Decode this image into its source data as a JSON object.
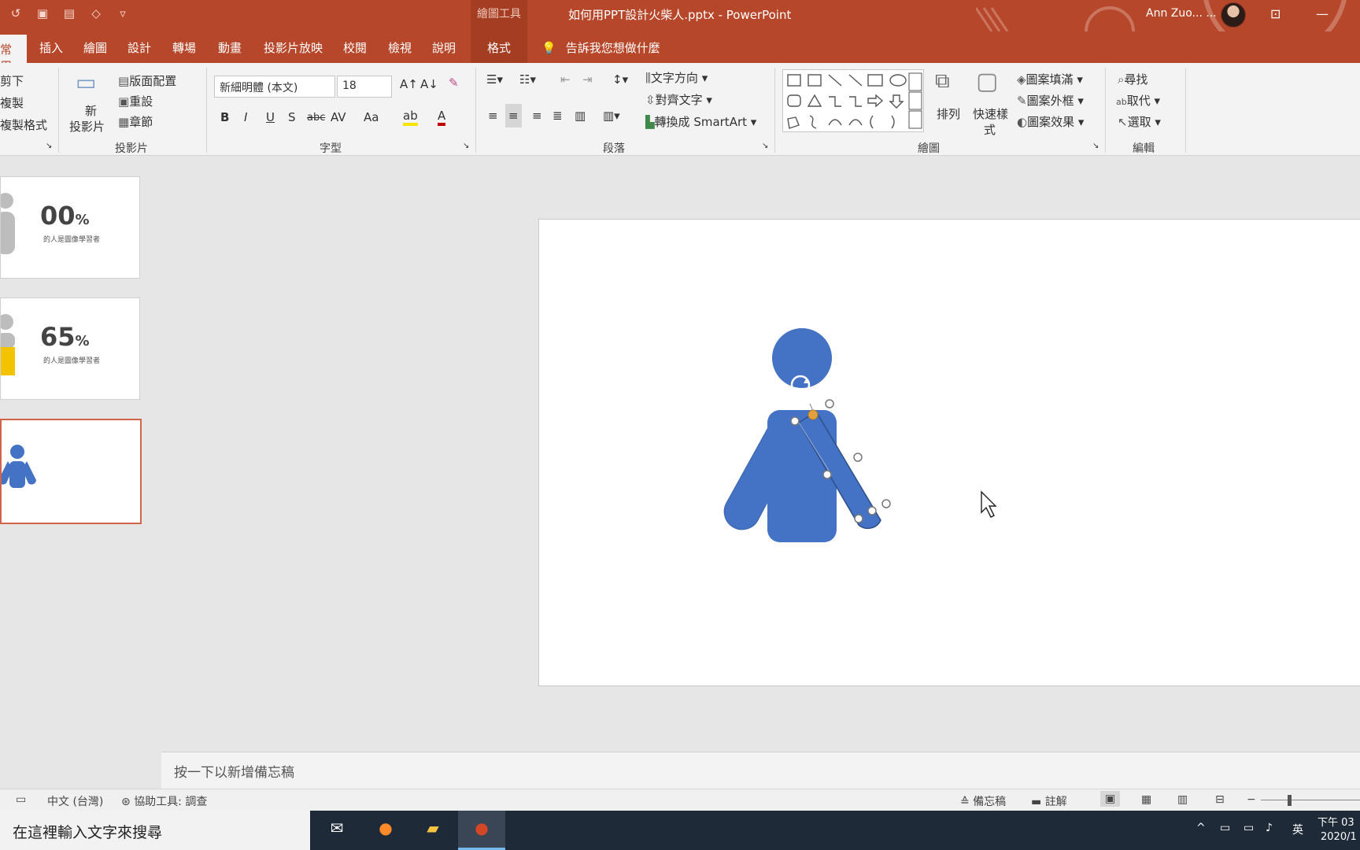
{
  "titlebar": {
    "context_group": "繪圖工具",
    "document_title": "如何用PPT設計火柴人.pptx  -  PowerPoint",
    "user_name": "Ann Zuo... ...",
    "qat_icons": [
      "undo-icon",
      "slideshow-icon",
      "format-painter-icon",
      "shapes-icon",
      "customize-icon"
    ]
  },
  "tabs": {
    "home": "常用",
    "insert": "插入",
    "draw": "繪圖",
    "design": "設計",
    "transitions": "轉場",
    "animations": "動畫",
    "slideshow": "投影片放映",
    "review": "校閱",
    "view": "檢視",
    "help": "說明",
    "format": "格式",
    "tellme": "告訴我您想做什麼"
  },
  "ribbon": {
    "clipboard": {
      "cut": "剪下",
      "copy": "複製",
      "format_painter": "複製格式"
    },
    "slides": {
      "new_slide_1": "新",
      "new_slide_2": "投影片",
      "layout": "版面配置",
      "reset": "重設",
      "section": "章節",
      "label": "投影片"
    },
    "font": {
      "name": "新細明體 (本文)",
      "size": "18",
      "label": "字型",
      "bold": "B",
      "italic": "I",
      "underline": "U",
      "shadow": "S",
      "strike": "abc",
      "spacing": "AV",
      "case": "Aa",
      "color": "A"
    },
    "paragraph": {
      "text_direction": "文字方向",
      "align_text": "對齊文字",
      "smartart": "轉換成 SmartArt",
      "label": "段落"
    },
    "drawing": {
      "arrange": "排列",
      "quick_styles_1": "快速樣",
      "quick_styles_2": "式",
      "fill": "圖案填滿",
      "outline": "圖案外框",
      "effects": "圖案效果",
      "label": "繪圖"
    },
    "editing": {
      "find": "尋找",
      "replace": "取代",
      "select": "選取",
      "label": "編輯"
    }
  },
  "thumbnails": [
    {
      "number": "00",
      "percent": "%",
      "caption": "的人是圖像學習者"
    },
    {
      "number": "65",
      "percent": "%",
      "caption": "的人是圖像學習者"
    },
    {
      "number": "",
      "percent": "",
      "caption": ""
    }
  ],
  "notes_placeholder": "按一下以新增備忘稿",
  "statusbar": {
    "language": "中文 (台灣)",
    "accessibility": "協助工具: 調查",
    "notes": "備忘稿",
    "comments": "註解"
  },
  "taskbar": {
    "search_placeholder": "在這裡輸入文字來搜尋",
    "ime": "英",
    "time": "下午 03",
    "date": "2020/1"
  },
  "colors": {
    "accent": "#b7472a",
    "figure": "#4472c4",
    "handle_yellow": "#e2a03f",
    "thumb_yellow": "#f4c300"
  }
}
